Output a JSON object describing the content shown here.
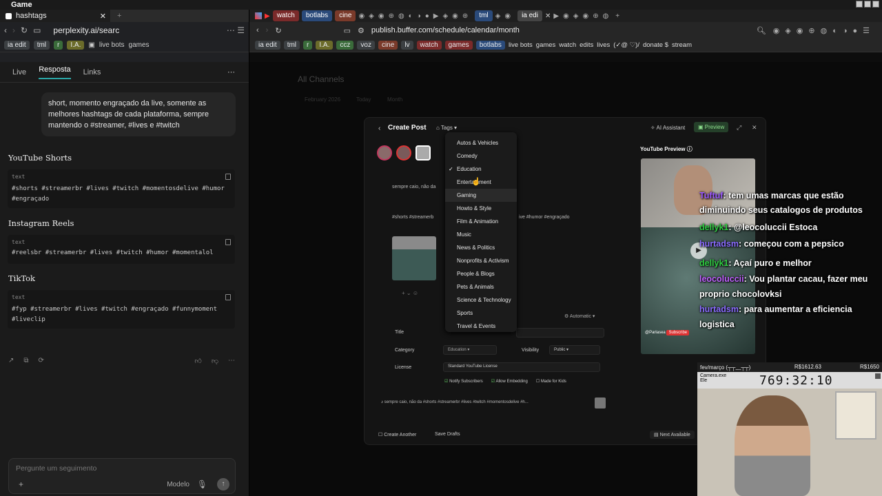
{
  "window_title": "Game",
  "left": {
    "tab_title": "hashtags",
    "address": "perplexity.ai/searc",
    "bookmarks": [
      "ia edit",
      "tml",
      "r",
      "I.A.",
      "live bots",
      "games"
    ],
    "tabs": [
      "Live",
      "Resposta",
      "Links"
    ],
    "user_message": "short, momento engraçado da live, somente as melhores hashtags de cada plataforma, sempre mantendo o #streamer, #lives e #twitch",
    "sections": [
      {
        "title": "YouTube Shorts",
        "lang": "text",
        "code": "#shorts #streamerbr #lives #twitch #momentosdelive #humor #engraçado"
      },
      {
        "title": "Instagram Reels",
        "lang": "text",
        "code": "#reelsbr #streamerbr #lives #twitch #humor #momentalol"
      },
      {
        "title": "TikTok",
        "lang": "text",
        "code": "#fyp #streamerbr #lives #twitch #engraçado #funnymoment #liveclip"
      }
    ],
    "input_placeholder": "Pergunte um seguimento",
    "model_label": "Modelo"
  },
  "right": {
    "tabs": [
      "watch",
      "botlabs",
      "cine",
      "tml",
      "ia edi"
    ],
    "address": "publish.buffer.com/schedule/calendar/month",
    "bookmarks": [
      "ia edit",
      "tml",
      "r",
      "I.A.",
      "ccz",
      "voz",
      "cine",
      "lv",
      "watch",
      "games",
      "botlabs",
      "live bots",
      "games",
      "watch",
      "edits",
      "lives",
      "(✓@ ♡)/",
      "donate $",
      "stream"
    ],
    "bg_title": "All Channels",
    "bg_month": "February 2026",
    "bg_today": "Today",
    "bg_view": "Month",
    "modal": {
      "title": "Create Post",
      "tags_label": "Tags",
      "ai_assistant": "AI Assistant",
      "preview_button": "Preview",
      "caption_snippet": "sempre caio, não da",
      "hashtags_snippet": "#shorts #streamerb",
      "hashtags_tail": "ive #humor #engraçado",
      "automatic": "Automatic",
      "title_label": "Title",
      "category_label": "Category",
      "category_value": "Education",
      "visibility_label": "Visibility",
      "visibility_value": "Public",
      "license_label": "License",
      "license_value": "Standard YouTube License",
      "notify": "Notify Subscribers",
      "allow_embed": "Allow Embedding",
      "made_for_kids": "Made for Kids",
      "tiktok_caption": "sempre caio, não da #shorts #streamerbr #lives #twitch #momentosdelive #h...",
      "create_another": "Create Another",
      "save_drafts": "Save Drafts",
      "next_available": "Next Available"
    },
    "category_menu": {
      "items": [
        "Autos & Vehicles",
        "Comedy",
        "Education",
        "Entertainment",
        "Gaming",
        "Howto & Style",
        "Film & Animation",
        "Music",
        "News & Politics",
        "Nonprofits & Activism",
        "People & Blogs",
        "Pets & Animals",
        "Science & Technology",
        "Sports",
        "Travel & Events"
      ],
      "checked": "Education",
      "hovered": "Gaming"
    },
    "youtube_preview_label": "YouTube Preview",
    "yt_channel": "@Parlasea",
    "yt_subscribe": "Subscribe"
  },
  "overlay_chat": [
    {
      "user": "Tuftuf",
      "text": ": tem umas marcas que estão diminuindo seus catalogos de produtos",
      "color": "#9b59ff"
    },
    {
      "user": "dellyk1",
      "text": ": @leocoluccii Estoca",
      "color": "#2ecc40"
    },
    {
      "user": "hurtadsm",
      "text": ": começou com a pepsico",
      "color": "#8a6bff"
    },
    {
      "user": "dellyk1",
      "text": ": Açaí puro e melhor",
      "color": "#2ecc40"
    },
    {
      "user": "leocoluccii",
      "text": ": Vou plantar cacau, fazer meu proprio chocolovksi",
      "color": "#c060ff"
    },
    {
      "user": "hurtadsm",
      "text": ": para aumentar a eficiencia logistica",
      "color": "#8a6bff"
    }
  ],
  "camera": {
    "header_left": "fev/março (┬┬﹏┬┬)",
    "money_left": "R$1612.63",
    "money_right": "R$1650",
    "app_title": "Camera.exe",
    "app_sub": "Ele",
    "timer": "769:32:10"
  }
}
